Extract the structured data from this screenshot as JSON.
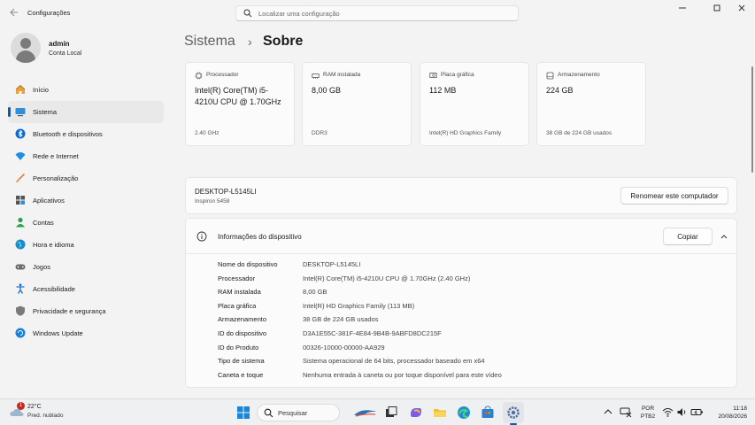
{
  "window": {
    "app_title": "Configurações",
    "search_placeholder": "Localizar uma configuração"
  },
  "user": {
    "name": "admin",
    "account_type": "Conta Local"
  },
  "nav": {
    "items": [
      {
        "label": "Início",
        "icon": "home-icon"
      },
      {
        "label": "Sistema",
        "icon": "system-icon",
        "active": true
      },
      {
        "label": "Bluetooth e dispositivos",
        "icon": "bluetooth-icon"
      },
      {
        "label": "Rede e Internet",
        "icon": "network-icon"
      },
      {
        "label": "Personalização",
        "icon": "brush-icon"
      },
      {
        "label": "Aplicativos",
        "icon": "apps-icon"
      },
      {
        "label": "Contas",
        "icon": "accounts-icon"
      },
      {
        "label": "Hora e idioma",
        "icon": "globe-icon"
      },
      {
        "label": "Jogos",
        "icon": "gamepad-icon"
      },
      {
        "label": "Acessibilidade",
        "icon": "accessibility-icon"
      },
      {
        "label": "Privacidade e segurança",
        "icon": "shield-icon"
      },
      {
        "label": "Windows Update",
        "icon": "update-icon"
      }
    ]
  },
  "breadcrumb": {
    "parent": "Sistema",
    "separator": "›",
    "current": "Sobre"
  },
  "cards": [
    {
      "title": "Processador",
      "value": "Intel(R) Core(TM) i5-4210U CPU @ 1.70GHz",
      "footer": "2.40 GHz",
      "icon": "cpu-icon"
    },
    {
      "title": "RAM instalada",
      "value": "8,00 GB",
      "footer": "DDR3",
      "icon": "ram-icon"
    },
    {
      "title": "Placa gráfica",
      "value": "112 MB",
      "footer": "Intel(R) HD Graphics Family",
      "icon": "gpu-icon"
    },
    {
      "title": "Armazenamento",
      "value": "224 GB",
      "footer": "38 GB de 224 GB usados",
      "icon": "storage-icon"
    }
  ],
  "rename_panel": {
    "device_name": "DESKTOP-L5145LI",
    "model": "Inspiron 5458",
    "button": "Renomear este computador"
  },
  "device_info": {
    "title": "Informações do dispositivo",
    "copy_button": "Copiar",
    "rows": [
      {
        "key": "Nome do dispositivo",
        "value": "DESKTOP-L5145LI"
      },
      {
        "key": "Processador",
        "value": "Intel(R) Core(TM) i5-4210U CPU @ 1.70GHz (2.40 GHz)"
      },
      {
        "key": "RAM instalada",
        "value": "8,00 GB"
      },
      {
        "key": "Placa gráfica",
        "value": "Intel(R) HD Graphics Family (113 MB)"
      },
      {
        "key": "Armazenamento",
        "value": "38 GB de 224 GB usados"
      },
      {
        "key": "ID do dispositivo",
        "value": "D3A1E55C-381F-4E84-9B4B-9ABFD8DC215F"
      },
      {
        "key": "ID do Produto",
        "value": "00326-10000-00000-AA929"
      },
      {
        "key": "Tipo de sistema",
        "value": "Sistema operacional de 64 bits, processador baseado em x64"
      },
      {
        "key": "Caneta e toque",
        "value": "Nenhuma entrada à caneta ou por toque disponível para este vídeo"
      }
    ]
  },
  "taskbar": {
    "weather": {
      "temp": "22°C",
      "desc": "Pred. nublado",
      "badge": "1"
    },
    "search_label": "Pesquisar",
    "language": "POR",
    "layout": "PTB2",
    "time": "11:18",
    "date": "20/08/2026"
  },
  "colors": {
    "accent": "#005fb8",
    "background": "#f3f3f3",
    "card": "#fbfbfb"
  }
}
